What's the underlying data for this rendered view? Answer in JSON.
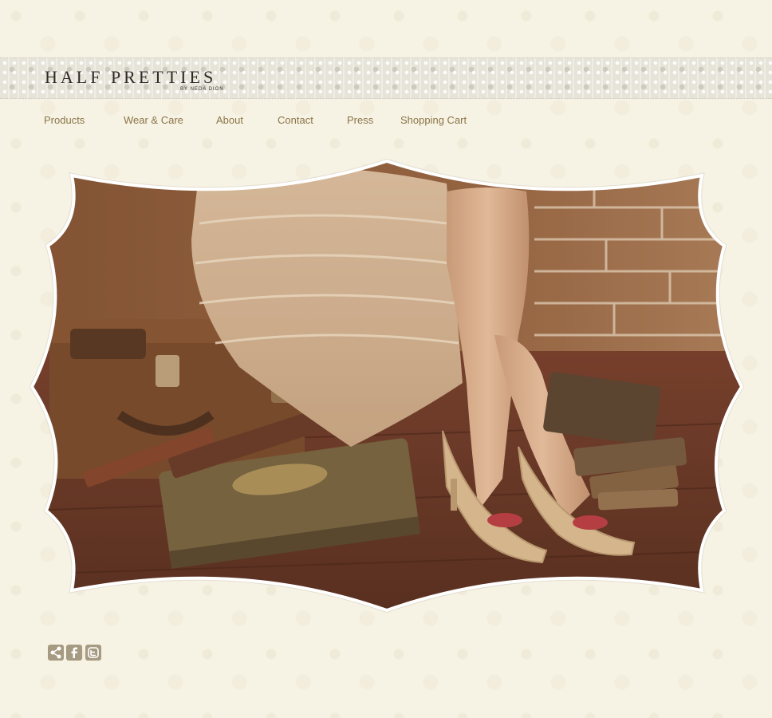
{
  "brand": {
    "title": "HALF PRETTIES",
    "subtitle": "BY NEDA DION"
  },
  "nav": {
    "items": [
      {
        "label": "Products"
      },
      {
        "label": "Wear & Care"
      },
      {
        "label": "About"
      },
      {
        "label": "Contact"
      },
      {
        "label": "Press"
      },
      {
        "label": "Shopping Cart"
      }
    ]
  },
  "hero": {
    "icon": "hero-photo-image"
  },
  "social": {
    "share_icon": "share-icon",
    "facebook_icon": "facebook-icon",
    "twitter_icon": "twitter-icon"
  },
  "colors": {
    "background": "#f7f3e4",
    "nav_text": "#8a7448",
    "logo_text": "#2f2a26",
    "social_bg": "#a79a82"
  }
}
